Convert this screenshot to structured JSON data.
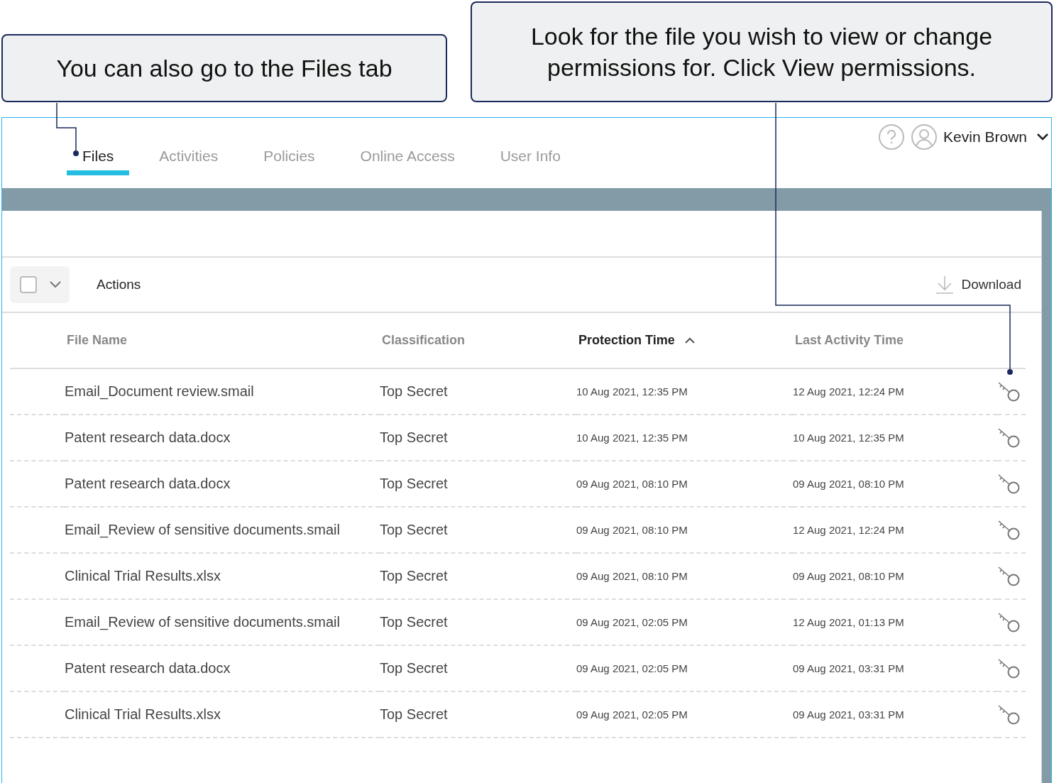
{
  "callouts": [
    {
      "text": "You can also go to the Files tab"
    },
    {
      "text": "Look for the file you wish to view or change permissions for. Click View permissions."
    }
  ],
  "tabs": [
    {
      "label": "Files",
      "selected": true
    },
    {
      "label": "Activities",
      "selected": false
    },
    {
      "label": "Policies",
      "selected": false
    },
    {
      "label": "Online Access",
      "selected": false
    },
    {
      "label": "User Info",
      "selected": false
    }
  ],
  "user": {
    "name": "Kevin Brown"
  },
  "toolbar": {
    "select_all": {
      "checked": false
    },
    "actions": "Actions",
    "download": "Download"
  },
  "table": {
    "columns": [
      {
        "label": "File Name",
        "sorted": false
      },
      {
        "label": "Classification",
        "sorted": false
      },
      {
        "label": "Protection Time",
        "sorted": true
      },
      {
        "label": "Last Activity Time",
        "sorted": false
      }
    ],
    "rows": [
      {
        "file": "Email_Document review.smail",
        "classification": "Top Secret",
        "protection_time": "10 Aug 2021, 12:35 PM",
        "last_activity": "12 Aug 2021, 12:24 PM"
      },
      {
        "file": "Patent research data.docx",
        "classification": "Top Secret",
        "protection_time": "10 Aug 2021, 12:35 PM",
        "last_activity": "10 Aug 2021, 12:35 PM"
      },
      {
        "file": "Patent research data.docx",
        "classification": "Top Secret",
        "protection_time": "09 Aug 2021, 08:10 PM",
        "last_activity": "09 Aug 2021, 08:10 PM"
      },
      {
        "file": "Email_Review of sensitive documents.smail",
        "classification": "Top Secret",
        "protection_time": "09 Aug 2021, 08:10 PM",
        "last_activity": "12 Aug 2021, 12:24 PM"
      },
      {
        "file": "Clinical Trial Results.xlsx",
        "classification": "Top Secret",
        "protection_time": "09 Aug 2021, 08:10 PM",
        "last_activity": "09 Aug 2021, 08:10 PM"
      },
      {
        "file": "Email_Review of sensitive documents.smail",
        "classification": "Top Secret",
        "protection_time": "09 Aug 2021, 02:05 PM",
        "last_activity": "12 Aug 2021, 01:13 PM"
      },
      {
        "file": "Patent research data.docx",
        "classification": "Top Secret",
        "protection_time": "09 Aug 2021, 02:05 PM",
        "last_activity": "09 Aug 2021, 03:31 PM"
      },
      {
        "file": "Clinical Trial Results.xlsx",
        "classification": "Top Secret",
        "protection_time": "09 Aug 2021, 02:05 PM",
        "last_activity": "09 Aug 2021, 03:31 PM"
      }
    ]
  }
}
